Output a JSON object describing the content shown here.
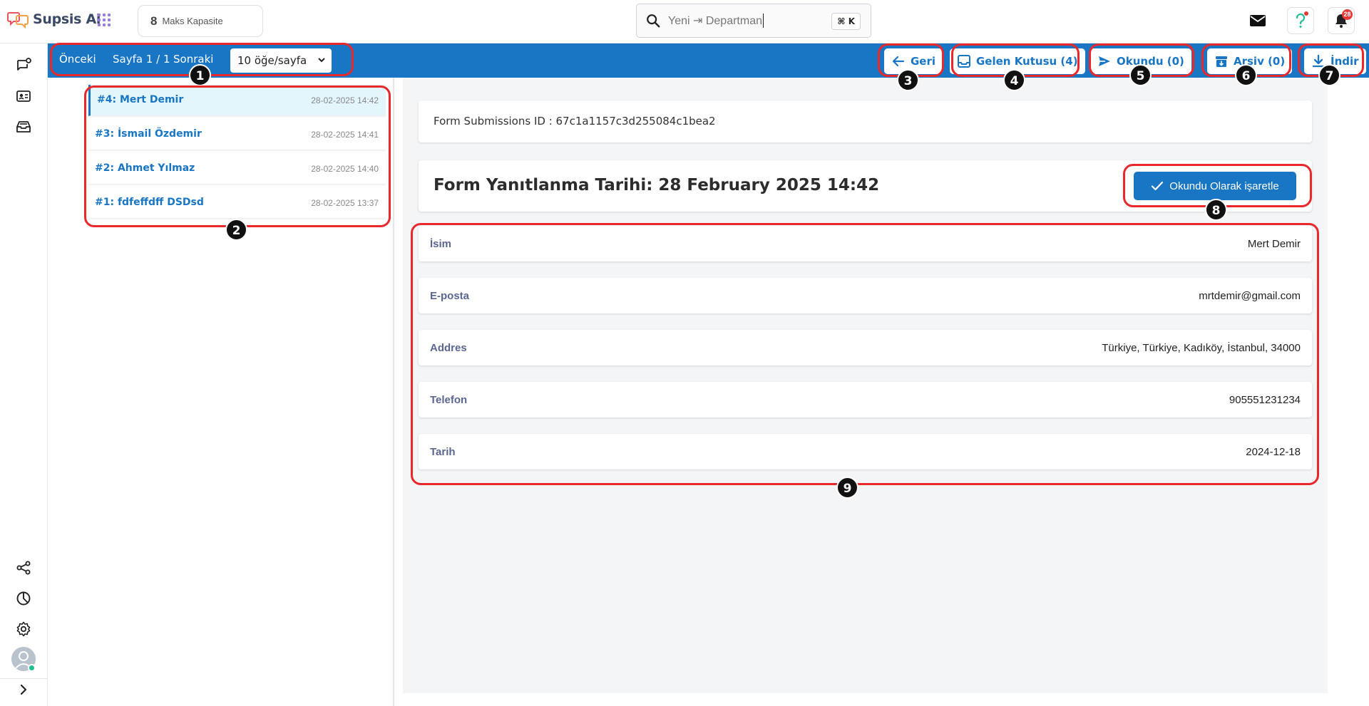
{
  "brand": {
    "name": "Supsis Ai"
  },
  "capacity": {
    "value": "8",
    "label": "Maks Kapasite"
  },
  "search": {
    "placeholder": "Yeni ⇥ Departman",
    "shortcut": "⌘ K"
  },
  "notifications": {
    "count": "28"
  },
  "toolbar": {
    "prev": "Önceki",
    "page": "Sayfa 1 / 1",
    "next": "Sonraki",
    "per_page": "10 öğe/sayfa",
    "back": "Geri",
    "inbox": "Gelen Kutusu (4)",
    "read": "Okundu (0)",
    "archive": "Arşiv (0)",
    "download": "İndir"
  },
  "submissions": [
    {
      "title": "#4: Mert Demir",
      "date": "28-02-2025 14:42"
    },
    {
      "title": "#3: İsmail Özdemir",
      "date": "28-02-2025 14:41"
    },
    {
      "title": "#2: Ahmet Yılmaz",
      "date": "28-02-2025 14:40"
    },
    {
      "title": "#1: fdfeffdff DSDsd",
      "date": "28-02-2025 13:37"
    }
  ],
  "detail": {
    "submission_id": "Form Submissions ID : 67c1a1157c3d255084c1bea2",
    "answered_date": "Form Yanıtlanma Tarihi: 28 February 2025 14:42",
    "mark_read": "Okundu Olarak işaretle",
    "fields": [
      {
        "label": "İsim",
        "value": "Mert Demir"
      },
      {
        "label": "E-posta",
        "value": "mrtdemir@gmail.com"
      },
      {
        "label": "Addres",
        "value": "Türkiye, Türkiye, Kadıköy, İstanbul, 34000"
      },
      {
        "label": "Telefon",
        "value": "905551231234"
      },
      {
        "label": "Tarih",
        "value": "2024-12-18"
      }
    ]
  },
  "annotations": [
    "1",
    "2",
    "3",
    "4",
    "5",
    "6",
    "7",
    "8",
    "9"
  ],
  "colors": {
    "primary": "#1976c5",
    "annotation": "#e8282b",
    "active_row": "#e3f6fb"
  }
}
